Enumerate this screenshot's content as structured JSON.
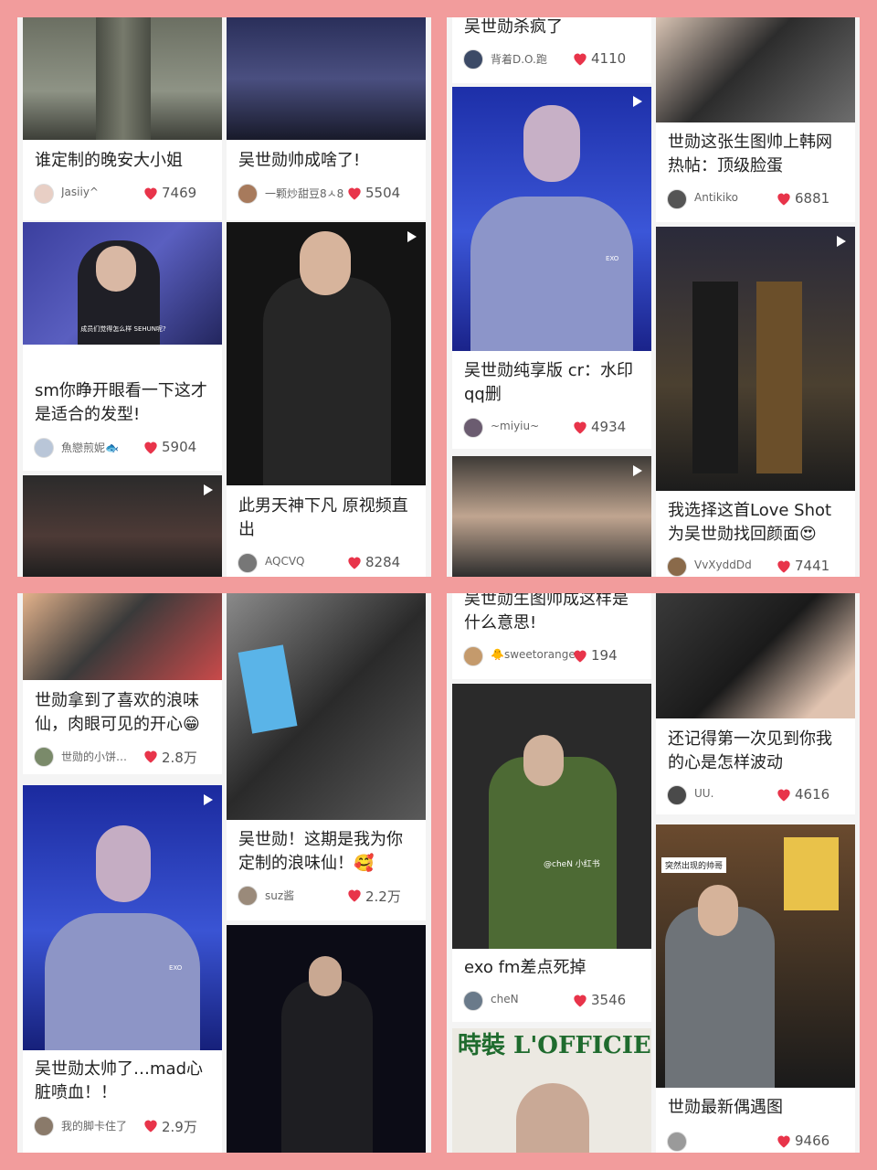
{
  "colors": {
    "frame": "#f29c9c",
    "heart": "#e8344a"
  },
  "panels": [
    {
      "cards": [
        {
          "title": "谁定制的晚安大小姐",
          "author": "Jasiiy^",
          "likes": "7469",
          "icon": "heart-icon"
        },
        {
          "title": "吴世勋帅成啥了!",
          "author": "一颗炒甜豆8ㅅ8",
          "likes": "5504",
          "icon": "heart-icon"
        },
        {
          "title": "sm你睁开眼看一下这才是适合的发型!",
          "author": "魚戀煎妮🐟",
          "likes": "5904",
          "overlay": "成员们觉得怎么样 SEHUN呢?"
        },
        {
          "title": "此男天神下凡 原视频直出",
          "author": "AQCVQ",
          "likes": "8284",
          "video": true
        },
        {
          "video": true
        }
      ]
    },
    {
      "cards": [
        {
          "title": "吴世勋杀疯了",
          "author": "背着D.O.跑",
          "likes": "4110"
        },
        {
          "title": "世勋这张生图帅上韩网热帖：顶级脸蛋",
          "author": "Antikiko",
          "likes": "6881"
        },
        {
          "title": "吴世勋纯享版 cr：水印qq删",
          "author": "~miyiu~",
          "likes": "4934",
          "video": true,
          "overlay": "EXO"
        },
        {
          "title": "我选择这首Love Shot为吴世勋找回颜面😍",
          "author": "VvXyddDd",
          "likes": "7441",
          "video": true
        },
        {
          "video": true
        }
      ]
    },
    {
      "cards": [
        {
          "title": "世勋拿到了喜欢的浪味仙，肉眼可见的开心😁",
          "author": "世勋的小饼…",
          "likes": "2.8万"
        },
        {
          "title": "吴世勋！这期是我为你定制的浪味仙！🥰",
          "author": "suz酱",
          "likes": "2.2万"
        },
        {
          "title": "吴世勋太帅了…mad心脏喷血！！",
          "author": "我的脚卡住了",
          "likes": "2.9万",
          "video": true,
          "overlay": "EXO"
        },
        {}
      ]
    },
    {
      "cards": [
        {
          "title": "吴世勋生图帅成这样是什么意思!",
          "author": "🐥sweetorange",
          "likes": "194"
        },
        {
          "title": "还记得第一次见到你我的心是怎样波动",
          "author": "UU.",
          "likes": "4616"
        },
        {
          "title": "exo fm差点死掉",
          "author": "cheN",
          "likes": "3546",
          "overlay": "@cheN  小红书"
        },
        {
          "title": "世勋最新偶遇图",
          "author": "",
          "likes": "9466",
          "overlay": "突然出现的帅哥"
        },
        {
          "magazine": "時裝 L'OFFICIEL"
        }
      ]
    }
  ]
}
